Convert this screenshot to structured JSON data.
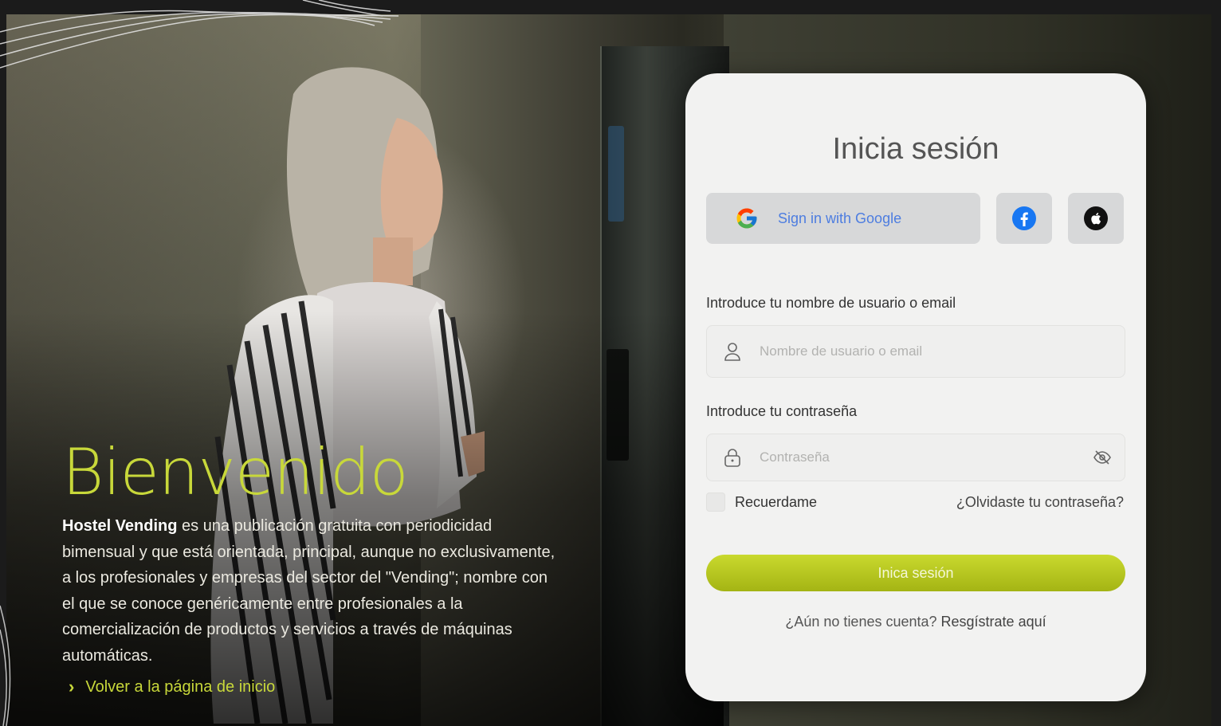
{
  "welcome": {
    "title": "Bienvenido",
    "brand": "Hostel Vending",
    "description": " es una publicación gratuita con periodicidad bimensual y que está orientada, principal, aunque no exclusivamente, a los profesionales y empresas del sector del \"Vending\"; nombre con el que se conoce genéricamente entre profesionales a la comercialización de productos y servicios a través de máquinas automáticas.",
    "back_link": "Volver a la página de inicio"
  },
  "login": {
    "title": "Inicia sesión",
    "google_label": "Sign in with Google",
    "social_icons": [
      "google-icon",
      "facebook-icon",
      "apple-icon"
    ],
    "username_label": "Introduce tu nombre de usuario o email",
    "username_placeholder": "Nombre de usuario o email",
    "password_label": "Introduce tu contraseña",
    "password_placeholder": "Contraseña",
    "remember_label": "Recuerdame",
    "forgot_label": "¿Olvidaste tu contraseña?",
    "submit_label": "Inica sesión",
    "register_prompt": "¿Aún no tienes cuenta? ",
    "register_link": "Resgístrate aquí"
  },
  "colors": {
    "accent": "#c8d83a",
    "card_bg": "#f2f2f1",
    "google_text": "#4d7de0"
  }
}
